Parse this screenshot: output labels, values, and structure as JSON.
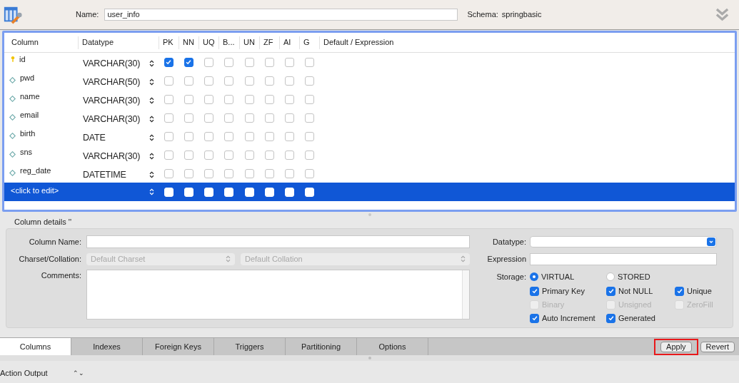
{
  "header": {
    "name_label": "Name:",
    "name_value": "user_info",
    "schema_label": "Schema:",
    "schema_value": "springbasic"
  },
  "grid": {
    "columns": [
      "Column",
      "Datatype",
      "PK",
      "NN",
      "UQ",
      "B...",
      "UN",
      "ZF",
      "AI",
      "G",
      "Default / Expression"
    ],
    "rows": [
      {
        "name": "id",
        "kind": "primary_key",
        "datatype": "VARCHAR(30)",
        "flags": [
          true,
          true,
          false,
          false,
          false,
          false,
          false,
          false
        ]
      },
      {
        "name": "pwd",
        "kind": "column",
        "datatype": "VARCHAR(50)",
        "flags": [
          false,
          false,
          false,
          false,
          false,
          false,
          false,
          false
        ]
      },
      {
        "name": "name",
        "kind": "column",
        "datatype": "VARCHAR(30)",
        "flags": [
          false,
          false,
          false,
          false,
          false,
          false,
          false,
          false
        ]
      },
      {
        "name": "email",
        "kind": "column",
        "datatype": "VARCHAR(30)",
        "flags": [
          false,
          false,
          false,
          false,
          false,
          false,
          false,
          false
        ]
      },
      {
        "name": "birth",
        "kind": "column",
        "datatype": "DATE",
        "flags": [
          false,
          false,
          false,
          false,
          false,
          false,
          false,
          false
        ]
      },
      {
        "name": "sns",
        "kind": "column",
        "datatype": "VARCHAR(30)",
        "flags": [
          false,
          false,
          false,
          false,
          false,
          false,
          false,
          false
        ]
      },
      {
        "name": "reg_date",
        "kind": "column",
        "datatype": "DATETIME",
        "flags": [
          false,
          false,
          false,
          false,
          false,
          false,
          false,
          false
        ]
      }
    ],
    "new_row": {
      "label": "<click to edit>",
      "selected": true,
      "flags": [
        false,
        false,
        false,
        false,
        false,
        false,
        false,
        false
      ]
    }
  },
  "details": {
    "title": "Column details ''",
    "column_name_label": "Column Name:",
    "charset_label": "Charset/Collation:",
    "charset": "Default Charset",
    "collation": "Default Collation",
    "comments_label": "Comments:",
    "datatype_label": "Datatype:",
    "expression_label": "Expression",
    "storage_label": "Storage:",
    "storage": [
      {
        "label": "VIRTUAL",
        "selected": true
      },
      {
        "label": "STORED",
        "selected": false
      }
    ],
    "options": [
      {
        "label": "Primary Key",
        "checked": true,
        "disabled": false
      },
      {
        "label": "Not NULL",
        "checked": true,
        "disabled": false
      },
      {
        "label": "Unique",
        "checked": true,
        "disabled": false
      },
      {
        "label": "Binary",
        "checked": false,
        "disabled": true
      },
      {
        "label": "Unsigned",
        "checked": false,
        "disabled": true
      },
      {
        "label": "ZeroFill",
        "checked": false,
        "disabled": true
      },
      {
        "label": "Auto Increment",
        "checked": true,
        "disabled": false
      },
      {
        "label": "Generated",
        "checked": true,
        "disabled": false
      }
    ]
  },
  "tabs": [
    {
      "label": "Columns",
      "selected": true
    },
    {
      "label": "Indexes",
      "selected": false
    },
    {
      "label": "Foreign Keys",
      "selected": false
    },
    {
      "label": "Triggers",
      "selected": false
    },
    {
      "label": "Partitioning",
      "selected": false
    },
    {
      "label": "Options",
      "selected": false
    }
  ],
  "buttons": [
    {
      "label": "Apply",
      "highlighted": true
    },
    {
      "label": "Revert",
      "highlighted": false
    }
  ],
  "output": {
    "label": "Action Output",
    "symbol": "⌃⌄"
  }
}
